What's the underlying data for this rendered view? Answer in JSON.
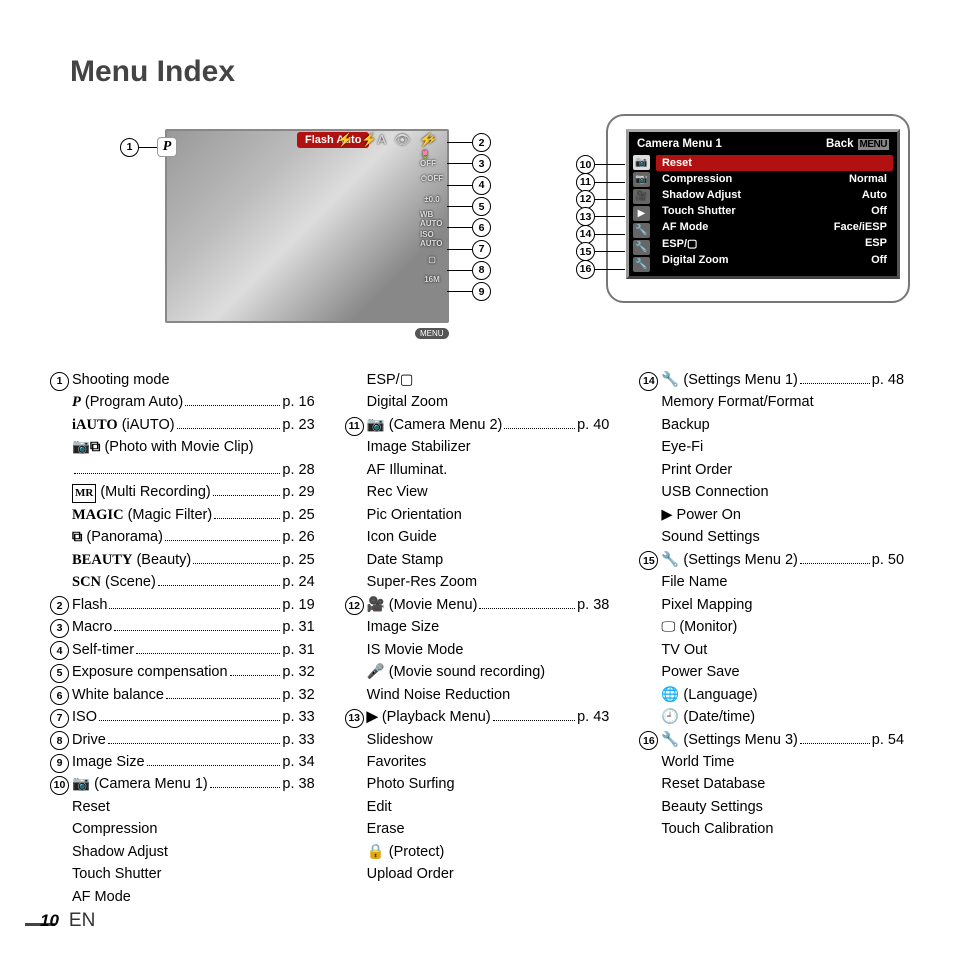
{
  "title": "Menu Index",
  "footer": {
    "page": "10",
    "lang": "EN"
  },
  "screen1": {
    "flash_label": "Flash Auto",
    "menu_label": "MENU",
    "p_label": "P",
    "right_icons": [
      "⚡",
      "🌷OFF",
      "⏱OFF",
      "±0.0",
      "WB AUTO",
      "ISO AUTO",
      "▢",
      "16M"
    ]
  },
  "screen2": {
    "header_title": "Camera Menu 1",
    "back_label": "Back",
    "menu_label": "MENU",
    "rows": [
      {
        "label": "Reset",
        "value": "",
        "hl": true
      },
      {
        "label": "Compression",
        "value": "Normal"
      },
      {
        "label": "Shadow Adjust",
        "value": "Auto"
      },
      {
        "label": "Touch Shutter",
        "value": "Off"
      },
      {
        "label": "AF Mode",
        "value": "Face/iESP"
      },
      {
        "label": "ESP/▢",
        "value": "ESP"
      },
      {
        "label": "Digital Zoom",
        "value": "Off"
      }
    ]
  },
  "callouts_right": [
    "2",
    "3",
    "4",
    "5",
    "6",
    "7",
    "8",
    "9"
  ],
  "callouts_cm": [
    "10",
    "11",
    "12",
    "13",
    "14",
    "15",
    "16"
  ],
  "col1": [
    {
      "n": "1",
      "label": "Shooting mode",
      "page": "",
      "subs": [
        {
          "icon": "P",
          "italic": true,
          "label": " (Program Auto)",
          "page": "p. 16"
        },
        {
          "icon": "iAUTO",
          "label": " (iAUTO)",
          "page": "p. 23"
        },
        {
          "icon": "📷⧉",
          "label": " (Photo with Movie Clip)",
          "page": ""
        },
        {
          "icon": "",
          "label": "",
          "page": "p. 28"
        },
        {
          "icon": "MR",
          "boxed": true,
          "label": " (Multi Recording)",
          "page": "p. 29"
        },
        {
          "icon": "MAGIC",
          "label": " (Magic Filter)",
          "page": "p. 25"
        },
        {
          "icon": "⧉",
          "label": " (Panorama)",
          "page": "p. 26"
        },
        {
          "icon": "BEAUTY",
          "label": " (Beauty)",
          "page": "p. 25"
        },
        {
          "icon": "SCN",
          "label": " (Scene)",
          "page": "p. 24"
        }
      ]
    },
    {
      "n": "2",
      "label": "Flash",
      "page": "p. 19"
    },
    {
      "n": "3",
      "label": "Macro",
      "page": "p. 31"
    },
    {
      "n": "4",
      "label": "Self-timer",
      "page": "p. 31"
    },
    {
      "n": "5",
      "label": "Exposure compensation",
      "page": "p. 32"
    },
    {
      "n": "6",
      "label": "White balance",
      "page": "p. 32"
    },
    {
      "n": "7",
      "label": "ISO",
      "page": "p. 33"
    },
    {
      "n": "8",
      "label": "Drive",
      "page": "p. 33"
    },
    {
      "n": "9",
      "label": "Image Size",
      "page": "p. 34"
    },
    {
      "n": "10",
      "icon": "📷",
      "label": " (Camera Menu 1)",
      "page": "p. 38",
      "subs_plain": [
        "Reset",
        "Compression",
        "Shadow Adjust",
        "Touch Shutter",
        "AF Mode"
      ]
    }
  ],
  "col2": {
    "lead_plain": [
      "ESP/▢",
      "Digital Zoom"
    ],
    "items": [
      {
        "n": "11",
        "icon": "📷",
        "label": " (Camera Menu 2)",
        "page": "p. 40",
        "subs_plain": [
          "Image Stabilizer",
          "AF Illuminat.",
          "Rec View",
          "Pic Orientation",
          "Icon Guide",
          "Date Stamp",
          "Super-Res Zoom"
        ]
      },
      {
        "n": "12",
        "icon": "🎥",
        "label": " (Movie Menu)",
        "page": "p. 38",
        "subs_plain": [
          "Image Size",
          "IS Movie Mode",
          "🎤 (Movie sound recording)",
          "Wind Noise Reduction"
        ]
      },
      {
        "n": "13",
        "icon": "▶",
        "label": " (Playback Menu)",
        "page": "p. 43",
        "subs_plain": [
          "Slideshow",
          "Favorites",
          "Photo Surfing",
          "Edit",
          "Erase",
          "🔒 (Protect)",
          "Upload Order"
        ]
      }
    ]
  },
  "col3": [
    {
      "n": "14",
      "icon": "🔧",
      "label": " (Settings Menu 1)",
      "page": "p. 48",
      "subs_plain": [
        "Memory Format/Format",
        "Backup",
        "Eye-Fi",
        "Print Order",
        "USB Connection",
        "▶ Power On",
        "Sound Settings"
      ]
    },
    {
      "n": "15",
      "icon": "🔧",
      "label": " (Settings Menu 2)",
      "page": "p. 50",
      "subs_plain": [
        "File Name",
        "Pixel Mapping",
        "🖵 (Monitor)",
        "TV Out",
        "Power Save",
        "🌐 (Language)",
        "🕘 (Date/time)"
      ]
    },
    {
      "n": "16",
      "icon": "🔧",
      "label": " (Settings Menu 3)",
      "page": "p. 54",
      "subs_plain": [
        "World Time",
        "Reset Database",
        "Beauty Settings",
        "Touch Calibration"
      ]
    }
  ]
}
